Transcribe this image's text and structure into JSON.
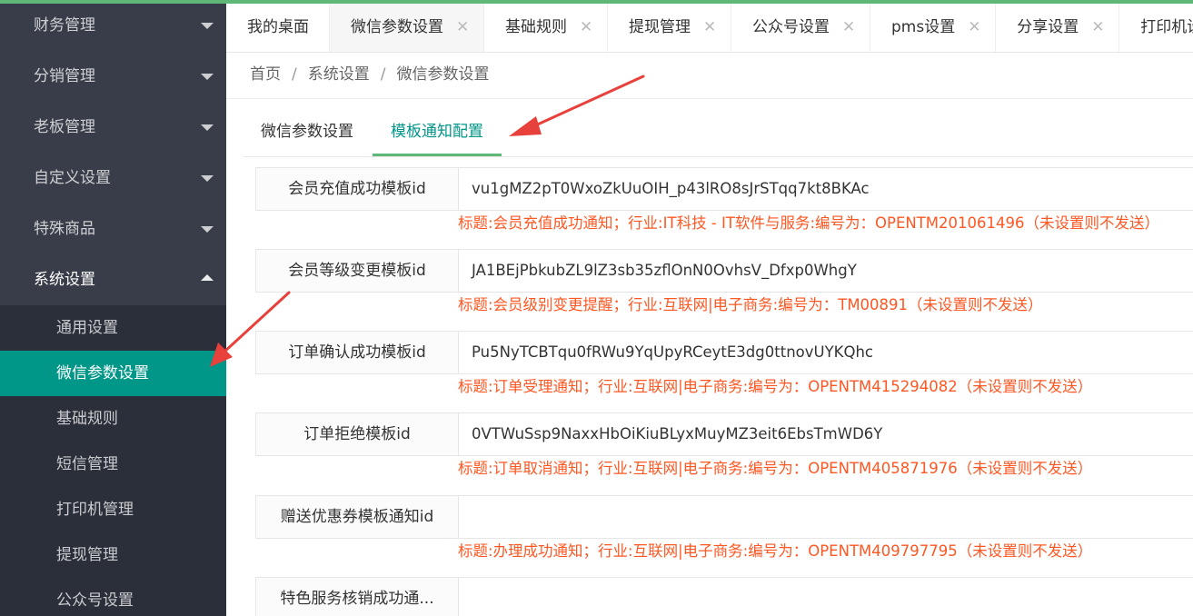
{
  "sidebar": {
    "menus": [
      {
        "label": "财务管理"
      },
      {
        "label": "分销管理"
      },
      {
        "label": "老板管理"
      },
      {
        "label": "自定义设置"
      },
      {
        "label": "特殊商品"
      },
      {
        "label": "系统设置"
      }
    ],
    "submenu": [
      {
        "label": "通用设置"
      },
      {
        "label": "微信参数设置"
      },
      {
        "label": "基础规则"
      },
      {
        "label": "短信管理"
      },
      {
        "label": "打印机管理"
      },
      {
        "label": "提现管理"
      },
      {
        "label": "公众号设置"
      }
    ]
  },
  "tabs": [
    {
      "label": "我的桌面"
    },
    {
      "label": "微信参数设置"
    },
    {
      "label": "基础规则"
    },
    {
      "label": "提现管理"
    },
    {
      "label": "公众号设置"
    },
    {
      "label": "pms设置"
    },
    {
      "label": "分享设置"
    },
    {
      "label": "打印机设置"
    }
  ],
  "tab_close_glyph": "✕",
  "breadcrumb": {
    "items": [
      "首页",
      "系统设置",
      "微信参数设置"
    ],
    "separator": "/"
  },
  "inner_tabs": {
    "tab1": "微信参数设置",
    "tab2": "模板通知配置"
  },
  "form": {
    "rows": [
      {
        "label": "会员充值成功模板id",
        "value": "vu1gMZ2pT0WxoZkUuOIH_p43lRO8sJrSTqq7kt8BKAc",
        "hint": "标题:会员充值成功通知；行业:IT科技 - IT软件与服务:编号为：OPENTM201061496（未设置则不发送）"
      },
      {
        "label": "会员等级变更模板id",
        "value": "JA1BEjPbkubZL9lZ3sb35zflOnN0OvhsV_Dfxp0WhgY",
        "hint": "标题:会员级别变更提醒；行业:互联网|电子商务:编号为：TM00891（未设置则不发送）"
      },
      {
        "label": "订单确认成功模板id",
        "value": "Pu5NyTCBTqu0fRWu9YqUpyRCeytE3dg0ttnovUYKQhc",
        "hint": "标题:订单受理通知；行业:互联网|电子商务:编号为：OPENTM415294082（未设置则不发送）"
      },
      {
        "label": "订单拒绝模板id",
        "value": "0VTWuSsp9NaxxHbOiKiuBLyxMuyMZ3eit6EbsTmWD6Y",
        "hint": "标题:订单取消通知；行业:互联网|电子商务:编号为：OPENTM405871976（未设置则不发送）"
      },
      {
        "label": "赠送优惠券模板通知id",
        "value": "",
        "hint": "标题:办理成功通知；行业:互联网|电子商务:编号为：OPENTM409797795（未设置则不发送）"
      },
      {
        "label": "特色服务核销成功通...",
        "value": "",
        "hint": ""
      }
    ]
  },
  "colors": {
    "accent": "#009688",
    "sidebar_bg": "#393d49",
    "hint_text": "#ff5722",
    "annotation_arrow": "#e8403a"
  }
}
